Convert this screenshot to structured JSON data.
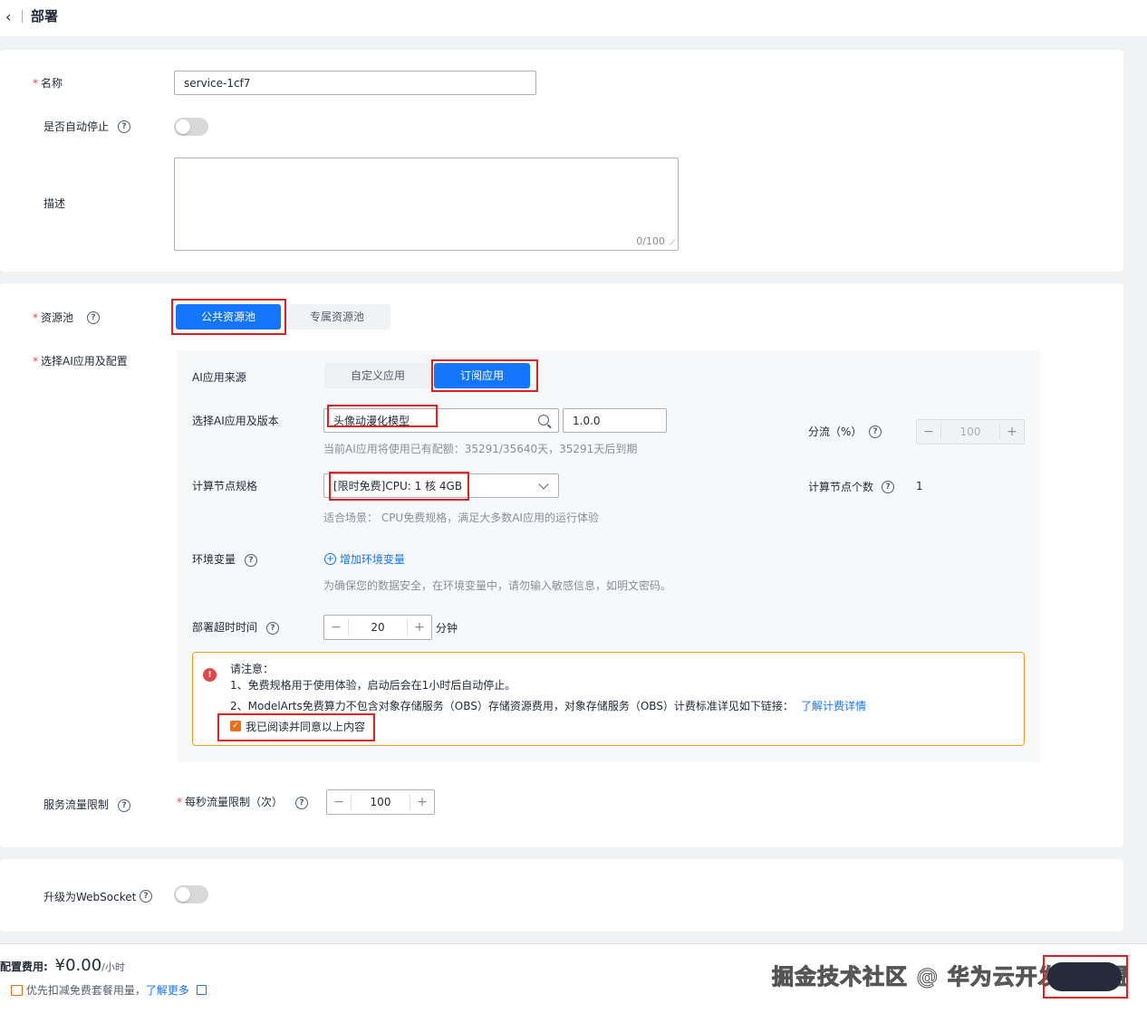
{
  "header": {
    "title": "部署"
  },
  "form": {
    "name_label": "名称",
    "name_value": "service-1cf7",
    "auto_stop_label": "是否自动停止",
    "desc_label": "描述",
    "desc_counter": "0/100",
    "pool_label": "资源池",
    "pool_public": "公共资源池",
    "pool_dedicated": "专属资源池",
    "ai_label": "选择AI应用及配置",
    "source_label": "AI应用来源",
    "source_custom": "自定义应用",
    "source_subscribed": "订阅应用",
    "app_label": "选择AI应用及版本",
    "app_value": "头像动漫化模型",
    "version_value": "1.0.0",
    "quota_hint": "当前AI应用将使用已有配额：35291/35640天，35291天后到期",
    "split_label": "分流（%）",
    "split_value": "100",
    "spec_label": "计算节点规格",
    "spec_value": "[限时免费]CPU: 1 核 4GB",
    "spec_hint": "适合场景： CPU免费规格，满足大多数AI应用的运行体验",
    "node_count_label": "计算节点个数",
    "node_count_value": "1",
    "env_label": "环境变量",
    "env_add": "增加环境变量",
    "env_hint": "为确保您的数据安全，在环境变量中，请勿输入敏感信息，如明文密码。",
    "timeout_label": "部署超时时间",
    "timeout_value": "20",
    "timeout_unit": "分钟",
    "notice_title": "请注意：",
    "notice_line1": "1、免费规格用于使用体验，启动后会在1小时后自动停止。",
    "notice_line2": "2、ModelArts免费算力不包含对象存储服务（OBS）存储资源费用，对象存储服务（OBS）计费标准详见如下链接：",
    "notice_link": "了解计费详情",
    "agree_label": "我已阅读并同意以上内容",
    "traffic_label": "服务流量限制",
    "qps_label": "每秒流量限制（次）",
    "qps_value": "100",
    "websocket_label": "升级为WebSocket"
  },
  "footer": {
    "fee_label": "配置费用:",
    "fee_value": "¥0.00",
    "fee_unit": "/小时",
    "promo_text": "优先扣减免费套餐用量，",
    "promo_link": "了解更多",
    "watermark": "掘金技术社区 @ 华为云开发者联盟"
  },
  "colors": {
    "primary": "#1476ff",
    "warning_border": "#f0a020",
    "checkbox": "#e96f1b",
    "annotation": "#e02020"
  }
}
